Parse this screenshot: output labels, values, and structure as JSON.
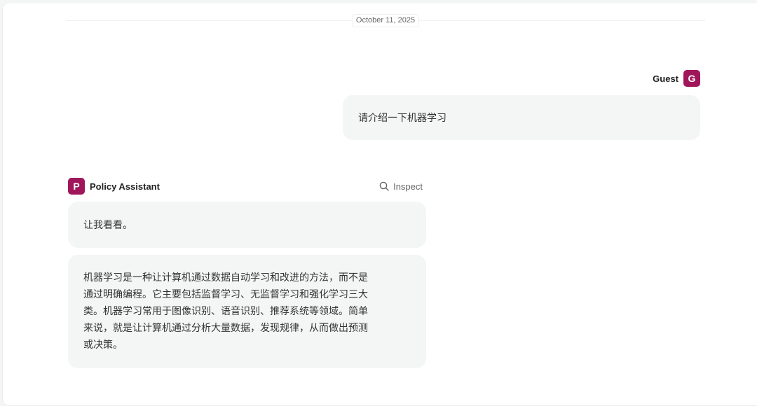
{
  "date_divider": "October 11, 2025",
  "user": {
    "name": "Guest",
    "avatar_letter": "G",
    "message": "请介绍一下机器学习"
  },
  "assistant": {
    "name": "Policy Assistant",
    "avatar_letter": "P",
    "inspect_label": "Inspect",
    "thinking_message": "让我看看。",
    "answer_message": "机器学习是一种让计算机通过数据自动学习和改进的方法，而不是通过明确编程。它主要包括监督学习、无监督学习和强化学习三大类。机器学习常用于图像识别、语音识别、推荐系统等领域。简单来说，就是让计算机通过分析大量数据，发现规律，从而做出预测或决策。"
  },
  "colors": {
    "avatar_bg": "#a0165a",
    "bubble_bg": "#f3f6f5",
    "page_bg": "#ffffff"
  },
  "icons": {
    "inspect": "search-icon"
  }
}
